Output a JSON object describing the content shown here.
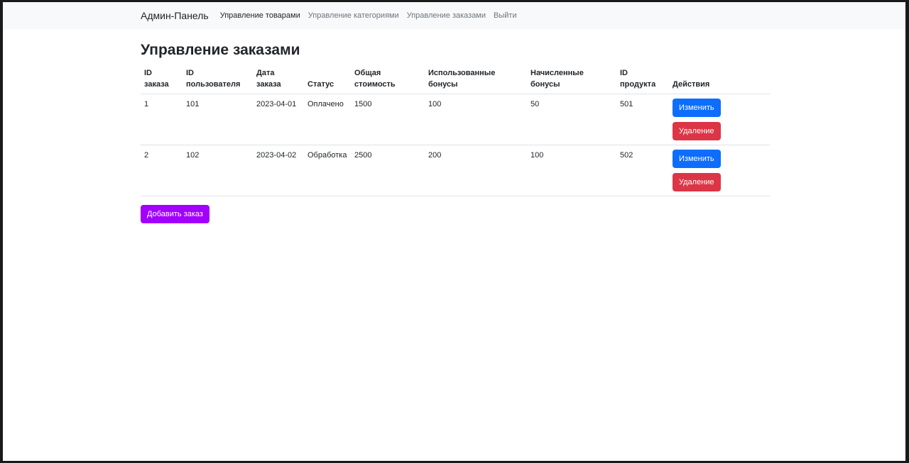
{
  "navbar": {
    "brand": "Админ-Панель",
    "links": [
      {
        "label": "Управление товарами"
      },
      {
        "label": "Управление категориями"
      },
      {
        "label": "Управление заказами"
      },
      {
        "label": "Выйти"
      }
    ]
  },
  "page": {
    "title": "Управление заказами",
    "add_button": "Добавить заказ"
  },
  "table": {
    "headers": [
      {
        "line1": "ID",
        "line2": "заказа"
      },
      {
        "line1": "ID",
        "line2": "пользователя"
      },
      {
        "line1": "Дата",
        "line2": "заказа"
      },
      {
        "line1": "",
        "line2": "Статус"
      },
      {
        "line1": "Общая",
        "line2": "стоимость"
      },
      {
        "line1": "Использованные",
        "line2": "бонусы"
      },
      {
        "line1": "Начисленные",
        "line2": "бонусы"
      },
      {
        "line1": "ID",
        "line2": "продукта"
      },
      {
        "line1": "",
        "line2": "Действия"
      }
    ],
    "rows": [
      {
        "id": "1",
        "user_id": "101",
        "date": "2023-04-01",
        "status": "Оплачено",
        "total": "1500",
        "used_bonus": "100",
        "earned_bonus": "50",
        "product_id": "501"
      },
      {
        "id": "2",
        "user_id": "102",
        "date": "2023-04-02",
        "status": "Обработка",
        "total": "2500",
        "used_bonus": "200",
        "earned_bonus": "100",
        "product_id": "502"
      }
    ],
    "edit_label": "Изменить",
    "delete_label": "Удаление"
  },
  "colors": {
    "edit": "#0d6efd",
    "delete": "#dc3545",
    "add": "#a100ff"
  }
}
